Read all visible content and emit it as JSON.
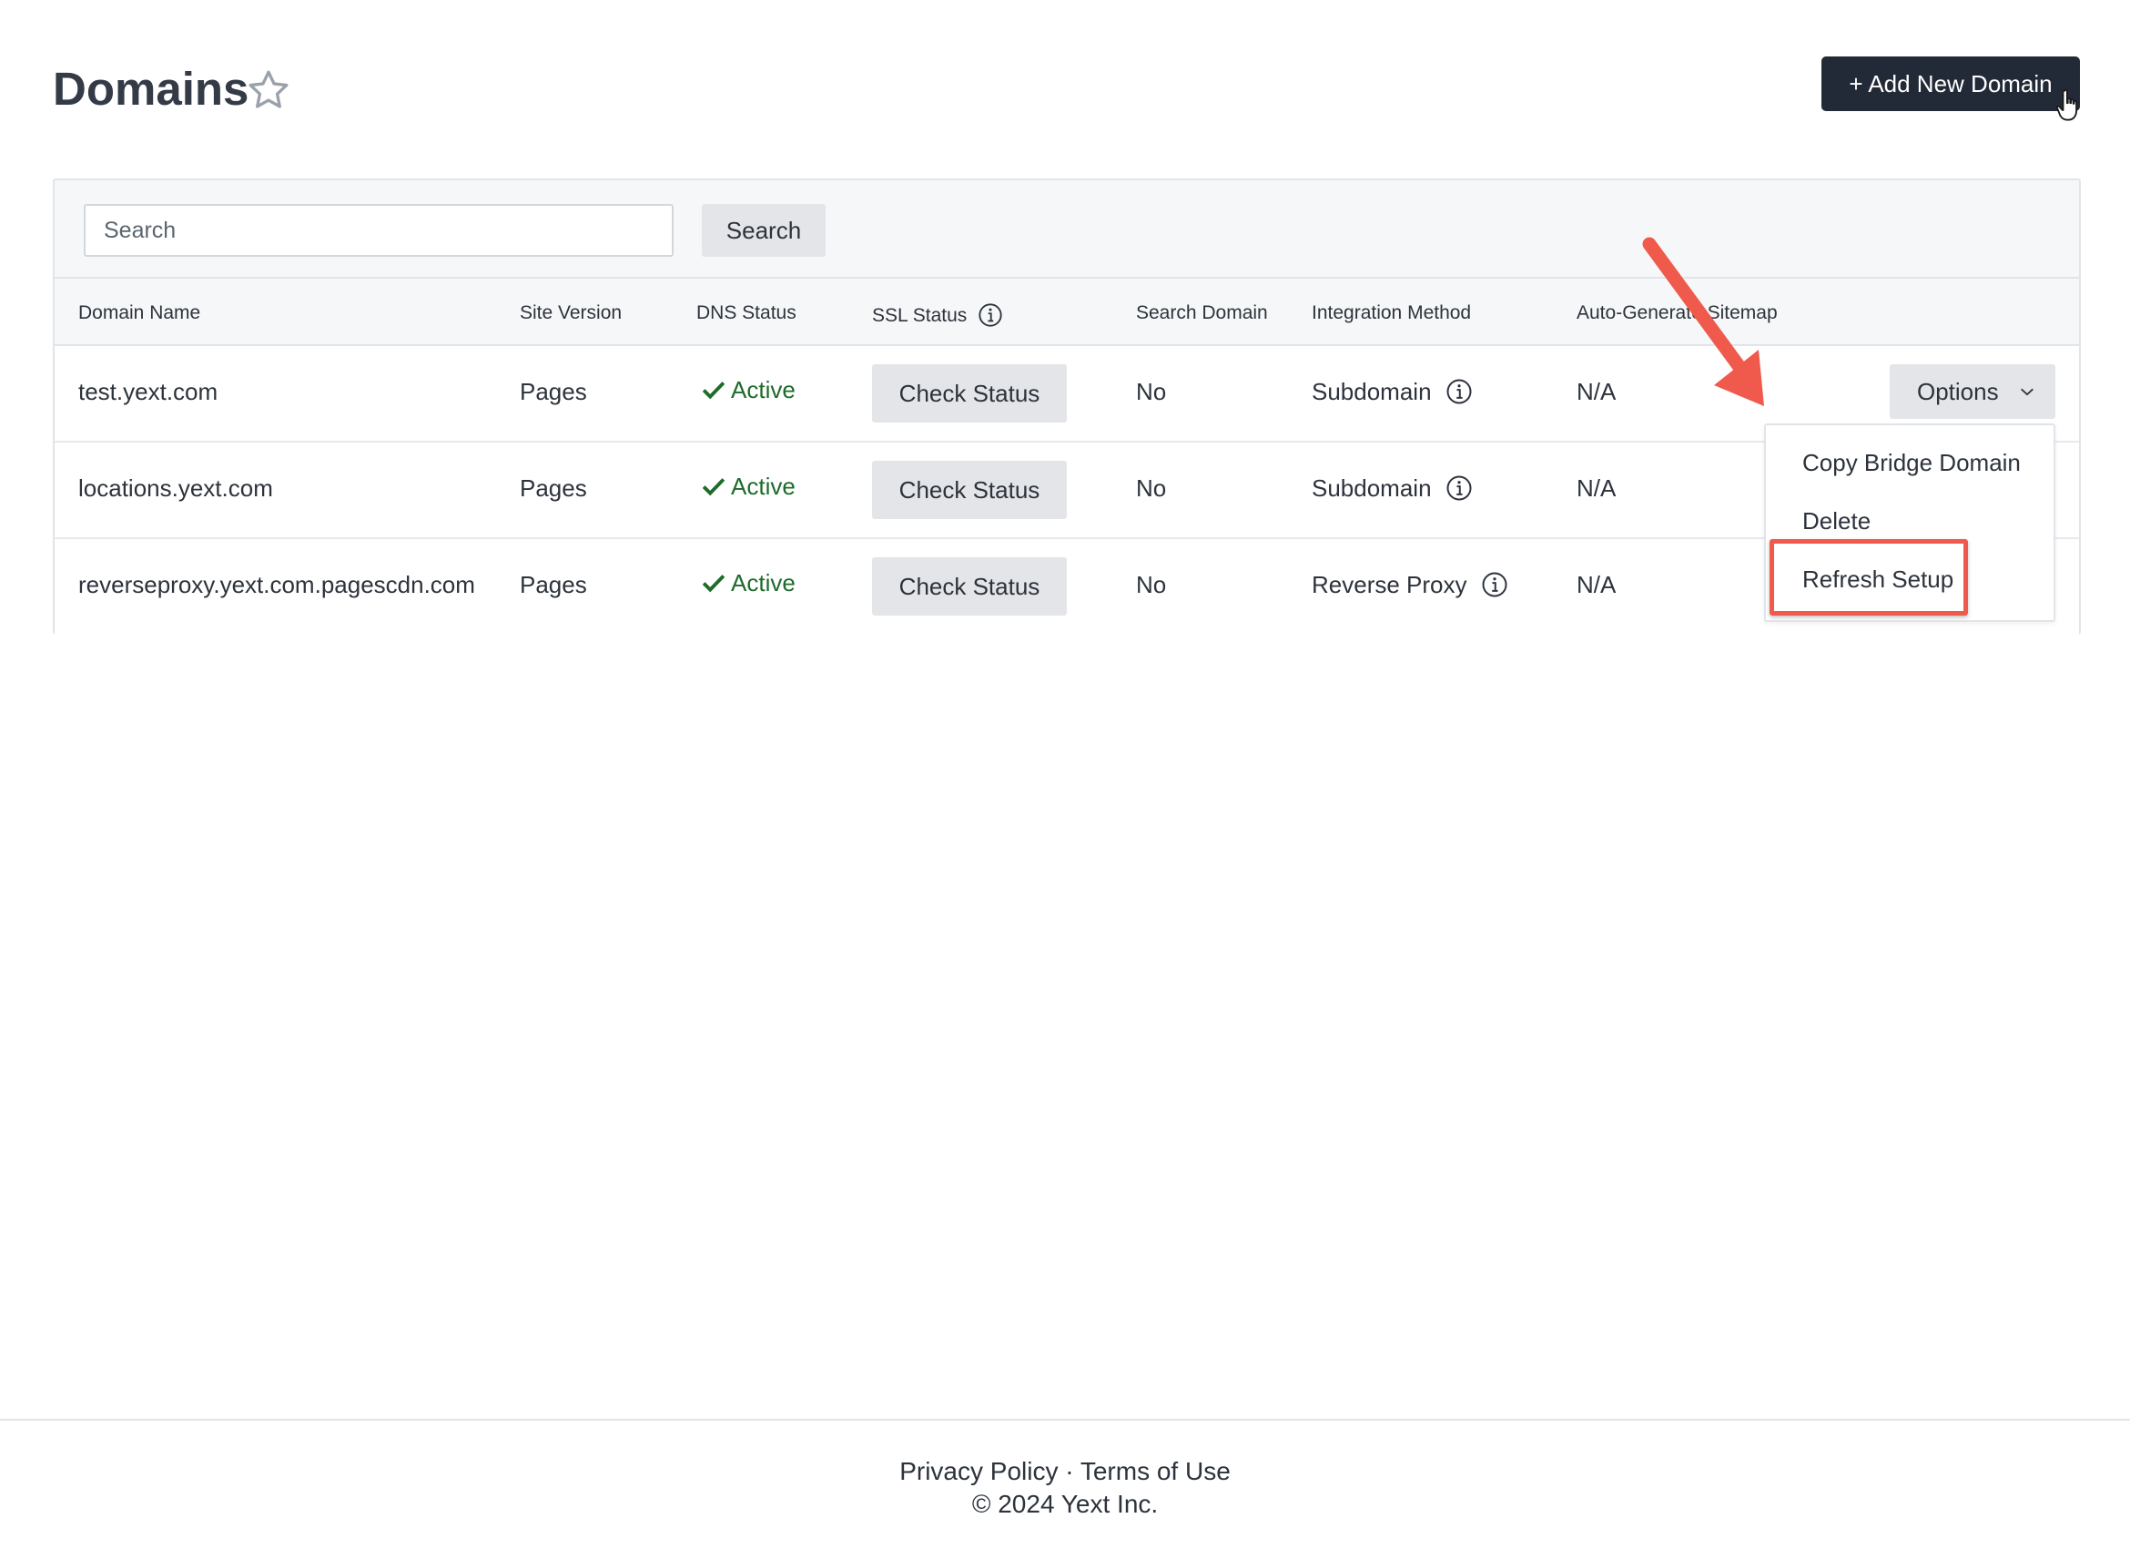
{
  "header": {
    "title": "Domains",
    "add_button": "+ Add New Domain"
  },
  "search": {
    "placeholder": "Search",
    "button": "Search"
  },
  "table": {
    "columns": [
      "Domain Name",
      "Site Version",
      "DNS Status",
      "SSL Status",
      "Search Domain",
      "Integration Method",
      "Auto-Generate Sitemap"
    ],
    "rows": [
      {
        "domain": "test.yext.com",
        "site_version": "Pages",
        "dns_status": "Active",
        "ssl_action": "Check Status",
        "search_domain": "No",
        "integration": "Subdomain",
        "sitemap": "N/A"
      },
      {
        "domain": "locations.yext.com",
        "site_version": "Pages",
        "dns_status": "Active",
        "ssl_action": "Check Status",
        "search_domain": "No",
        "integration": "Subdomain",
        "sitemap": "N/A"
      },
      {
        "domain": "reverseproxy.yext.com.pagescdn.com",
        "site_version": "Pages",
        "dns_status": "Active",
        "ssl_action": "Check Status",
        "search_domain": "No",
        "integration": "Reverse Proxy",
        "sitemap": "N/A"
      }
    ],
    "options_label": "Options"
  },
  "dropdown": {
    "items": [
      "Copy Bridge Domain",
      "Delete",
      "Refresh Setup"
    ]
  },
  "footer": {
    "privacy": "Privacy Policy",
    "separator": "·",
    "terms": "Terms of Use",
    "copyright": "© 2024 Yext Inc."
  },
  "colors": {
    "primary_button": "#232a37",
    "active_status": "#1e6b2a",
    "annotation": "#ef5a4c"
  }
}
